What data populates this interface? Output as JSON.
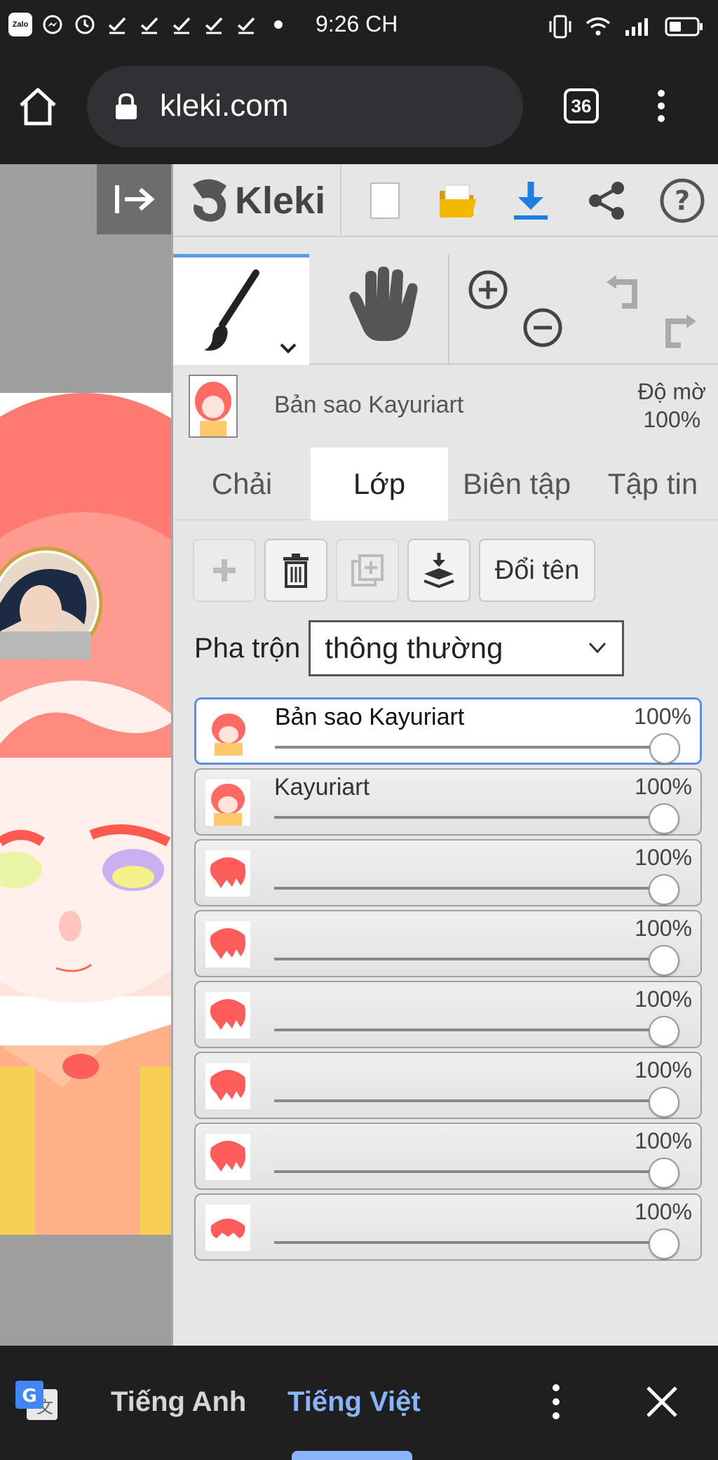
{
  "status_bar": {
    "time": "9:26 CH",
    "app_icon_label": "Zalo"
  },
  "browser": {
    "url": "kleki.com",
    "tab_count": "36"
  },
  "app": {
    "logo_text": "Kleki",
    "current_layer_name": "Bản sao Kayuriart",
    "opacity_label": "Độ mờ",
    "opacity_value": "100%"
  },
  "tabs": [
    {
      "label": "Chải"
    },
    {
      "label": "Lớp"
    },
    {
      "label": "Biên tập"
    },
    {
      "label": "Tập tin"
    }
  ],
  "actions": {
    "rename_label": "Đổi tên"
  },
  "blend": {
    "label": "Pha trộn",
    "value": "thông thường"
  },
  "layers": [
    {
      "name": "Bản sao Kayuriart",
      "opacity": "100%",
      "opacity_fraction": 1.0
    },
    {
      "name": "Kayuriart",
      "opacity": "100%",
      "opacity_fraction": 1.0
    },
    {
      "name": "",
      "opacity": "100%",
      "opacity_fraction": 1.0
    },
    {
      "name": "",
      "opacity": "100%",
      "opacity_fraction": 1.0
    },
    {
      "name": "",
      "opacity": "100%",
      "opacity_fraction": 1.0
    },
    {
      "name": "",
      "opacity": "100%",
      "opacity_fraction": 1.0
    },
    {
      "name": "",
      "opacity": "100%",
      "opacity_fraction": 1.0
    },
    {
      "name": "",
      "opacity": "100%",
      "opacity_fraction": 1.0
    }
  ],
  "translate_bar": {
    "source_lang": "Tiếng Anh",
    "target_lang": "Tiếng Việt"
  },
  "colors": {
    "accent": "#5b9ce4",
    "download_blue": "#1a7fe0",
    "folder_yellow": "#f5b800",
    "translate_blue": "#8ab4f8"
  }
}
